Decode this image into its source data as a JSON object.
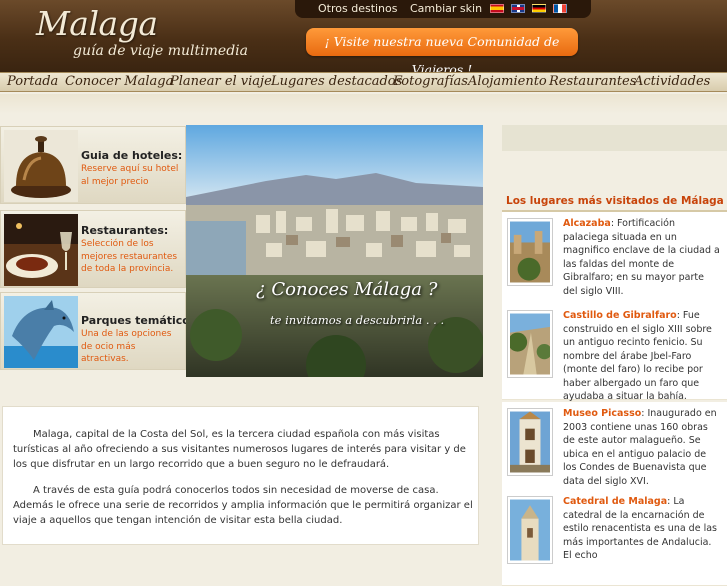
{
  "header": {
    "logo_title": "Malaga",
    "logo_subtitle": "guía de viaje multimedia",
    "top_links": [
      "Otros destinos",
      "Cambiar skin"
    ],
    "flags": [
      "flag-spain-icon",
      "flag-uk-icon",
      "flag-germany-icon",
      "flag-france-icon"
    ],
    "community_label": "¡ Visite nuestra nueva Comunidad de Viajeros !"
  },
  "nav": {
    "items": [
      "Portada",
      "Conocer Malaga",
      "Planear el viaje",
      "Lugares destacados",
      "Fotografías",
      "Alojamiento",
      "Restaurantes",
      "Actividades"
    ]
  },
  "left_boxes": [
    {
      "title": "Guia de hoteles:",
      "text": "Reserve aquí su hotel al mejor precio",
      "icon": "hotel-bell-icon"
    },
    {
      "title": "Restaurantes:",
      "text": "Selección de los mejores restaurantes de toda la provincia.",
      "icon": "restaurant-plate-icon"
    },
    {
      "title": "Parques temáticos:",
      "text": "Una de las opciones de ocio más atractivas.",
      "icon": "dolphin-icon"
    }
  ],
  "hero": {
    "title": "¿ Conoces Málaga ?",
    "subtitle": "te invitamos a descubrirla  . . ."
  },
  "intro": {
    "paragraph1": "Malaga, capital de la Costa del Sol, es la tercera ciudad española con más visitas turísticas al año ofreciendo a sus visitantes numerosos lugares de interés para visitar y de los que disfrutar en un largo recorrido que a buen seguro no le defraudará.",
    "paragraph2": "A través de esta guía podrá conocerlos todos sin necesidad de moverse de casa. Además le ofrece una serie de recorridos y amplia información que le permitirá organizar el viaje a aquellos que tengan intención de visitar esta bella ciudad."
  },
  "sidebar": {
    "heading": "Los lugares más visitados de Málaga",
    "items": [
      {
        "name": "Alcazaba",
        "desc": ": Fortificación palaciega situada en un magnifico enclave de la ciudad a las faldas del monte de Gibralfaro; en su mayor parte del siglo VIII."
      },
      {
        "name": "Castillo de Gibralfaro",
        "desc": ": Fue construido en el siglo XIII sobre un antiguo recinto fenicio. Su nombre del árabe Jbel-Faro (monte del faro) lo recibe por haber albergado un faro que ayudaba a situar la bahía."
      },
      {
        "name": "Museo Picasso",
        "desc": ": Inaugurado en 2003 contiene unas 160 obras de este autor malagueño. Se ubica en el antiguo palacio de los Condes de Buenavista que data del siglo XVI."
      },
      {
        "name": "Catedral de Malaga",
        "desc": ": La catedral de la encarnación de estilo renacentista es una de las más importantes de Andalucia. El echo"
      }
    ]
  }
}
